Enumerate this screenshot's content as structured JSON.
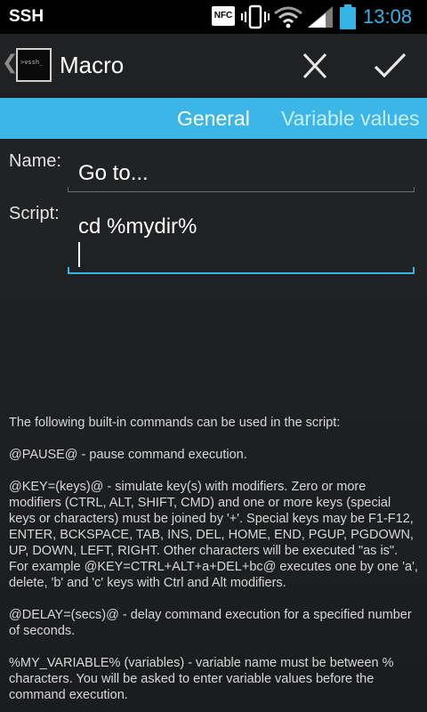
{
  "status_bar": {
    "carrier": "SSH",
    "nfc": "NFC",
    "time": "13:08",
    "icons": [
      "nfc-icon",
      "vibrate-icon",
      "wifi-icon",
      "signal-icon",
      "battery-icon"
    ],
    "accent_color": "#33b5e5"
  },
  "action_bar": {
    "up_icon": "back-caret-icon",
    "app_icon_text": ">vssh_",
    "title": "Macro",
    "cancel_icon": "close-icon",
    "done_icon": "check-icon"
  },
  "tabs": [
    {
      "label": "General",
      "selected": true
    },
    {
      "label": "Variable values",
      "selected": false
    }
  ],
  "tab_bar_color": "#3bb6e7",
  "form": {
    "name_label": "Name:",
    "name_value": "Go to...",
    "script_label": "Script:",
    "script_value": "cd %mydir%"
  },
  "help": {
    "intro": "The following built-in commands can be used in the script:",
    "pause": " @PAUSE@ - pause command execution.",
    "key": " @KEY=(keys)@ - simulate key(s) with modifiers. Zero or more modifiers (CTRL, ALT, SHIFT, CMD) and one or more keys (special keys or characters) must be joined by '+'. Special keys may be F1-F12, ENTER, BCKSPACE, TAB, INS, DEL, HOME, END, PGUP, PGDOWN, UP, DOWN, LEFT, RIGHT. Other characters will be executed \"as is\". For example @KEY=CTRL+ALT+a+DEL+bc@ executes one by one 'a', delete, 'b' and 'c' keys with Ctrl and Alt modifiers.",
    "delay": " @DELAY=(secs)@ - delay command execution for a specified number of seconds.",
    "variable": " %MY_VARIABLE% (variables) - variable name must be between % characters. You will be asked to enter variable values before the command execution."
  }
}
